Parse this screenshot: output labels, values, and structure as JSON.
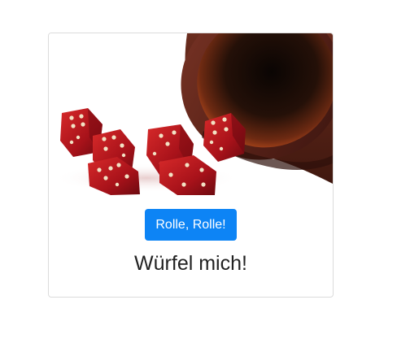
{
  "card": {
    "image_subject": "red-dice-and-leather-dice-cup",
    "button_label": "Rolle, Rolle!",
    "result_text": "Würfel mich!"
  },
  "colors": {
    "button_background": "#0d84f5",
    "button_text": "#ffffff",
    "card_border": "#dcdcdc",
    "dice_red": "#b3141c",
    "cup_brown": "#6b2a1c"
  }
}
